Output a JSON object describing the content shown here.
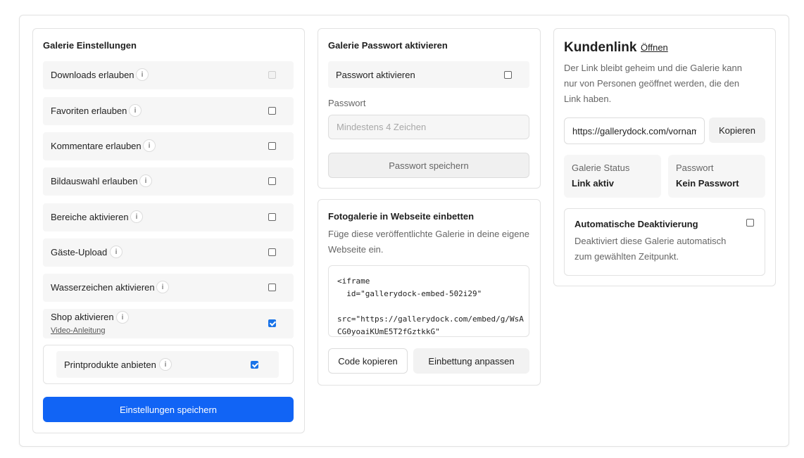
{
  "settings": {
    "title": "Galerie Einstellungen",
    "items": [
      {
        "label": "Downloads erlauben",
        "info": "i",
        "state": "disabled"
      },
      {
        "label": "Favoriten erlauben",
        "info": "i",
        "state": "unchecked"
      },
      {
        "label": "Kommentare erlauben",
        "info": "i",
        "state": "unchecked"
      },
      {
        "label": "Bildauswahl erlauben",
        "info": "i",
        "state": "unchecked"
      },
      {
        "label": "Bereiche aktivieren",
        "info": "i",
        "state": "unchecked"
      },
      {
        "label": "Gäste-Upload",
        "info": "i",
        "state": "unchecked"
      },
      {
        "label": "Wasserzeichen aktivieren",
        "info": "i",
        "state": "unchecked"
      },
      {
        "label": "Shop aktivieren",
        "info": "i",
        "state": "checked",
        "link": "Video-Anleitung"
      }
    ],
    "print_products": {
      "label": "Printprodukte anbieten",
      "info": "i",
      "state": "checked"
    },
    "save_button": "Einstellungen speichern"
  },
  "password": {
    "title": "Galerie Passwort aktivieren",
    "toggle_label": "Passwort aktivieren",
    "toggle_state": "unchecked",
    "field_label": "Passwort",
    "placeholder": "Mindestens 4 Zeichen",
    "save_button": "Passwort speichern"
  },
  "embed": {
    "title": "Fotogalerie in Webseite einbetten",
    "description": "Füge diese veröffentlichte Galerie in deine eigene Webseite ein.",
    "code": "<iframe\n  id=\"gallerydock-embed-502i29\"\n\nsrc=\"https://gallerydock.com/embed/g/WsA\nCG0yoaiKUmE5T2fGztkkG\"",
    "copy_button": "Code kopieren",
    "customize_button": "Einbettung anpassen"
  },
  "customer_link": {
    "title": "Kundenlink",
    "open_link": "Öffnen",
    "description": "Der Link bleibt geheim und die Galerie kann nur von Personen geöffnet werden, die den Link haben.",
    "url_value": "https://gallerydock.com/vorname",
    "copy_button": "Kopieren",
    "status": {
      "label": "Galerie Status",
      "value": "Link aktiv"
    },
    "password_status": {
      "label": "Passwort",
      "value": "Kein Passwort"
    },
    "auto_deactivation": {
      "title": "Automatische Deaktivierung",
      "description": "Deaktiviert diese Galerie automatisch zum gewählten Zeitpunkt.",
      "state": "unchecked"
    }
  },
  "colors": {
    "primary": "#1164f5",
    "checkbox_checked": "#1a73e8"
  }
}
